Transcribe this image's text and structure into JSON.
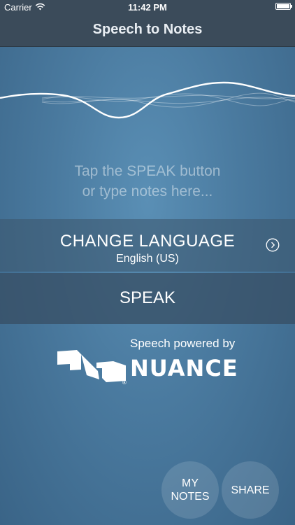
{
  "status_bar": {
    "carrier": "Carrier",
    "time": "11:42 PM",
    "wifi_icon": "wifi-icon",
    "battery_icon": "battery-icon"
  },
  "nav": {
    "title": "Speech to Notes"
  },
  "notes": {
    "placeholder_line1": "Tap the SPEAK button",
    "placeholder_line2": "or type notes here..."
  },
  "language": {
    "title": "CHANGE LANGUAGE",
    "current": "English (US)",
    "icon": "chevron-right-circle-icon"
  },
  "speak": {
    "label": "SPEAK"
  },
  "branding": {
    "powered_by": "Speech powered by",
    "brand": "NUANCE",
    "registered": "®"
  },
  "actions": {
    "my_notes_line1": "MY",
    "my_notes_line2": "NOTES",
    "share": "SHARE"
  },
  "colors": {
    "bar": "#3b4b5a",
    "background": "#4a7a9f"
  }
}
